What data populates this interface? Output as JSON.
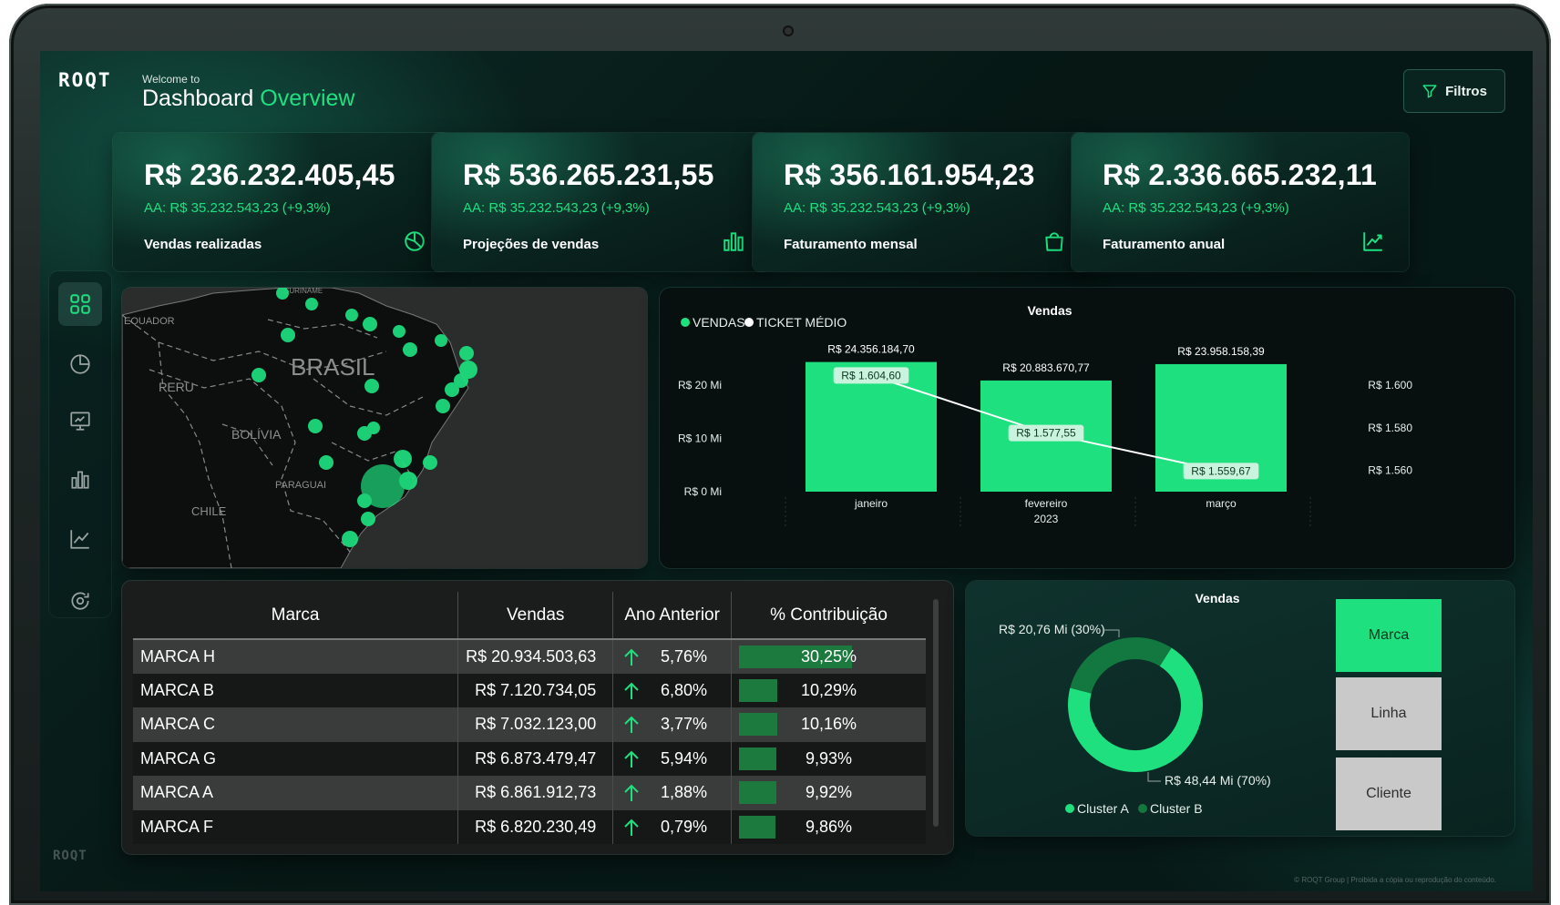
{
  "header": {
    "welcome": "Welcome to",
    "title_main": "Dashboard",
    "title_accent": "Overview",
    "logo": "ROQT",
    "filter_label": "Filtros"
  },
  "kpis": [
    {
      "value": "R$ 236.232.405,45",
      "aa": "AA: R$  35.232.543,23 (+9,3%)",
      "label": "Vendas realizadas",
      "icon": "pie-chart-icon"
    },
    {
      "value": "R$ 536.265.231,55",
      "aa": "AA: R$  35.232.543,23 (+9,3%)",
      "label": "Projeções de vendas",
      "icon": "bar-chart-icon"
    },
    {
      "value": "R$ 356.161.954,23",
      "aa": "AA: R$  35.232.543,23 (+9,3%)",
      "label": "Faturamento mensal",
      "icon": "shopping-bag-icon"
    },
    {
      "value": "R$ 2.336.665.232,11",
      "aa": "AA: R$  35.232.543,23 (+9,3%)",
      "label": "Faturamento anual",
      "icon": "line-chart-icon"
    }
  ],
  "sidebar": {
    "items": [
      {
        "icon": "dashboard-grid-icon",
        "active": true
      },
      {
        "icon": "pie-chart-icon",
        "active": false
      },
      {
        "icon": "monitor-chart-icon",
        "active": false
      },
      {
        "icon": "bar-chart-icon",
        "active": false
      },
      {
        "icon": "line-chart-icon",
        "active": false
      },
      {
        "icon": "refresh-target-icon",
        "active": false
      }
    ],
    "bottom_logo": "ROQT"
  },
  "map": {
    "labels": [
      "EQUADOR",
      "PERU",
      "BRASIL",
      "BOLÍVIA",
      "PARAGUAI",
      "CHILE",
      "SURINAME"
    ],
    "marker_color": "#1ee07f"
  },
  "chart_data": [
    {
      "type": "bar",
      "title": "Vendas",
      "legend": [
        "VENDAS",
        "TICKET MÉDIO"
      ],
      "categories": [
        "janeiro",
        "fevereiro",
        "março"
      ],
      "year_label": "2023",
      "series": [
        {
          "name": "VENDAS",
          "values": [
            24356184.7,
            20883670.77,
            23958158.39
          ],
          "labels": [
            "R$ 24.356.184,70",
            "R$ 20.883.670,77",
            "R$ 23.958.158,39"
          ],
          "axis": "left"
        },
        {
          "name": "TICKET MÉDIO",
          "type": "line",
          "values": [
            1604.6,
            1577.55,
            1559.67
          ],
          "labels": [
            "R$ 1.604,60",
            "R$ 1.577,55",
            "R$ 1.559,67"
          ],
          "axis": "right"
        }
      ],
      "y_left_ticks": [
        "R$ 20 Mi",
        "R$ 10 Mi",
        "R$ 0 Mi"
      ],
      "y_right_ticks": [
        "R$ 1.600",
        "R$ 1.580",
        "R$ 1.560"
      ],
      "ylim_left": [
        0,
        26000000
      ],
      "ylim_right": [
        1550,
        1615
      ],
      "colors": {
        "bar": "#1ee07f",
        "line": "#ffffff"
      }
    },
    {
      "type": "pie",
      "title": "Vendas",
      "slices": [
        {
          "name": "Cluster A",
          "value": 48.44,
          "label": "R$ 48,44 Mi (70%)",
          "color": "#1ee07f"
        },
        {
          "name": "Cluster B",
          "value": 20.76,
          "label": "R$ 20,76 Mi (30%)",
          "color": "#12783f"
        }
      ],
      "legend": [
        "Cluster A",
        "Cluster B"
      ]
    }
  ],
  "table": {
    "columns": [
      "Marca",
      "Vendas",
      "Ano Anterior",
      "% Contribuição"
    ],
    "rows": [
      {
        "brand": "MARCA H",
        "sales": "R$ 20.934.503,63",
        "prev": "5,76%",
        "contrib": "30,25%",
        "contrib_value": 30.25
      },
      {
        "brand": "MARCA B",
        "sales": "R$ 7.120.734,05",
        "prev": "6,80%",
        "contrib": "10,29%",
        "contrib_value": 10.29
      },
      {
        "brand": "MARCA C",
        "sales": "R$ 7.032.123,00",
        "prev": "3,77%",
        "contrib": "10,16%",
        "contrib_value": 10.16
      },
      {
        "brand": "MARCA G",
        "sales": "R$ 6.873.479,47",
        "prev": "5,94%",
        "contrib": "9,93%",
        "contrib_value": 9.93
      },
      {
        "brand": "MARCA A",
        "sales": "R$ 6.861.912,73",
        "prev": "1,88%",
        "contrib": "9,92%",
        "contrib_value": 9.92
      },
      {
        "brand": "MARCA F",
        "sales": "R$ 6.820.230,49",
        "prev": "0,79%",
        "contrib": "9,86%",
        "contrib_value": 9.86
      }
    ],
    "trend_icon": "arrow-up-icon",
    "accent": "#1ee07f"
  },
  "segment_buttons": [
    {
      "label": "Marca",
      "selected": true
    },
    {
      "label": "Linha",
      "selected": false
    },
    {
      "label": "Cliente",
      "selected": false
    }
  ],
  "footer": "© ROQT Group | Proibida a cópia ou reprodução do conteúdo."
}
